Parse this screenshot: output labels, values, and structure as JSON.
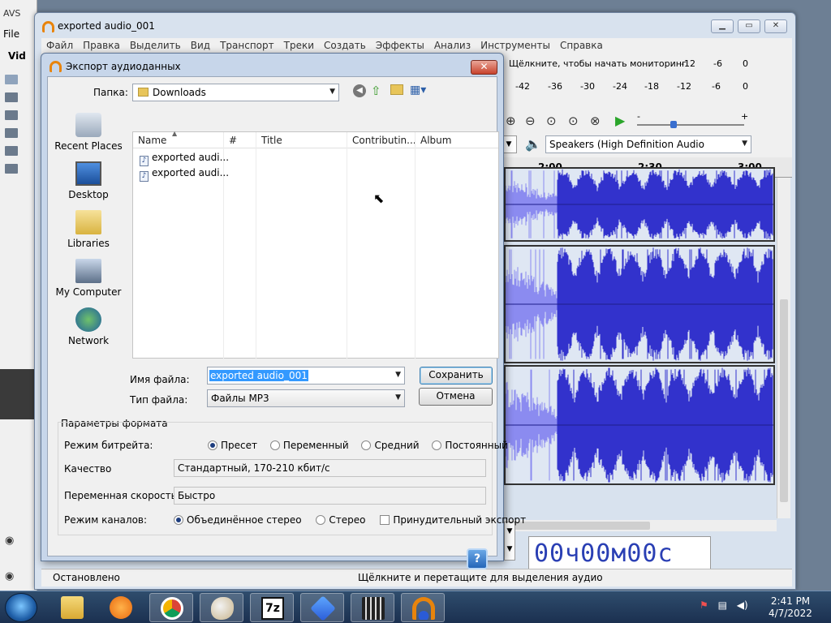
{
  "bg_app": {
    "title": "AVS",
    "menu": "File",
    "tab": "Vid"
  },
  "audacity": {
    "title": "exported audio_001",
    "menu": [
      "Файл",
      "Правка",
      "Выделить",
      "Вид",
      "Транспорт",
      "Треки",
      "Создать",
      "Эффекты",
      "Анализ",
      "Инструменты",
      "Справка"
    ],
    "monitor_text": "Щёлкните, чтобы начать мониторинг",
    "meter_top": [
      "-12",
      "-6",
      "0"
    ],
    "meter_bottom": [
      "-42",
      "-36",
      "-30",
      "-24",
      "-18",
      "-12",
      "-6",
      "0"
    ],
    "slider_minus": "-",
    "slider_plus": "+",
    "output_device": "Speakers (High Definition Audio",
    "timeline": [
      "2:00",
      "2:30",
      "3:00"
    ],
    "time_display": "00ч00м00с",
    "status_left": "Остановлено",
    "status_right": "Щёлкните и перетащите для выделения аудио"
  },
  "dialog": {
    "title": "Экспорт аудиоданных",
    "close_label": "✕",
    "folder_label": "Папка:",
    "folder_value": "Downloads",
    "places": [
      "Recent Places",
      "Desktop",
      "Libraries",
      "My Computer",
      "Network"
    ],
    "columns": [
      "Name",
      "#",
      "Title",
      "Contributin...",
      "Album"
    ],
    "files": [
      "exported audi...",
      "exported audi..."
    ],
    "filename_label": "Имя файла:",
    "filename_value": "exported audio_001",
    "filetype_label": "Тип файла:",
    "filetype_value": "Файлы MP3",
    "save_label": "Сохранить",
    "cancel_label": "Отмена",
    "format_group": "Параметры формата",
    "bitrate_label": "Режим битрейта:",
    "bitrate_options": [
      "Пресет",
      "Переменный",
      "Средний",
      "Постоянный"
    ],
    "bitrate_selected": 0,
    "quality_label": "Качество",
    "quality_value": "Стандартный, 170-210 кбит/с",
    "varspeed_label": "Переменная скорость:",
    "varspeed_value": "Быстро",
    "channel_label": "Режим каналов:",
    "channel_options": [
      "Объединённое стерео",
      "Стерео"
    ],
    "channel_selected": 0,
    "force_export_label": "Принудительный экспорт",
    "help_label": "?"
  },
  "taskbar": {
    "time": "2:41 PM",
    "date": "4/7/2022"
  },
  "colors": {
    "wave": "#3232cc",
    "wave_light": "#8b8bf0",
    "accent": "#e8840c"
  }
}
